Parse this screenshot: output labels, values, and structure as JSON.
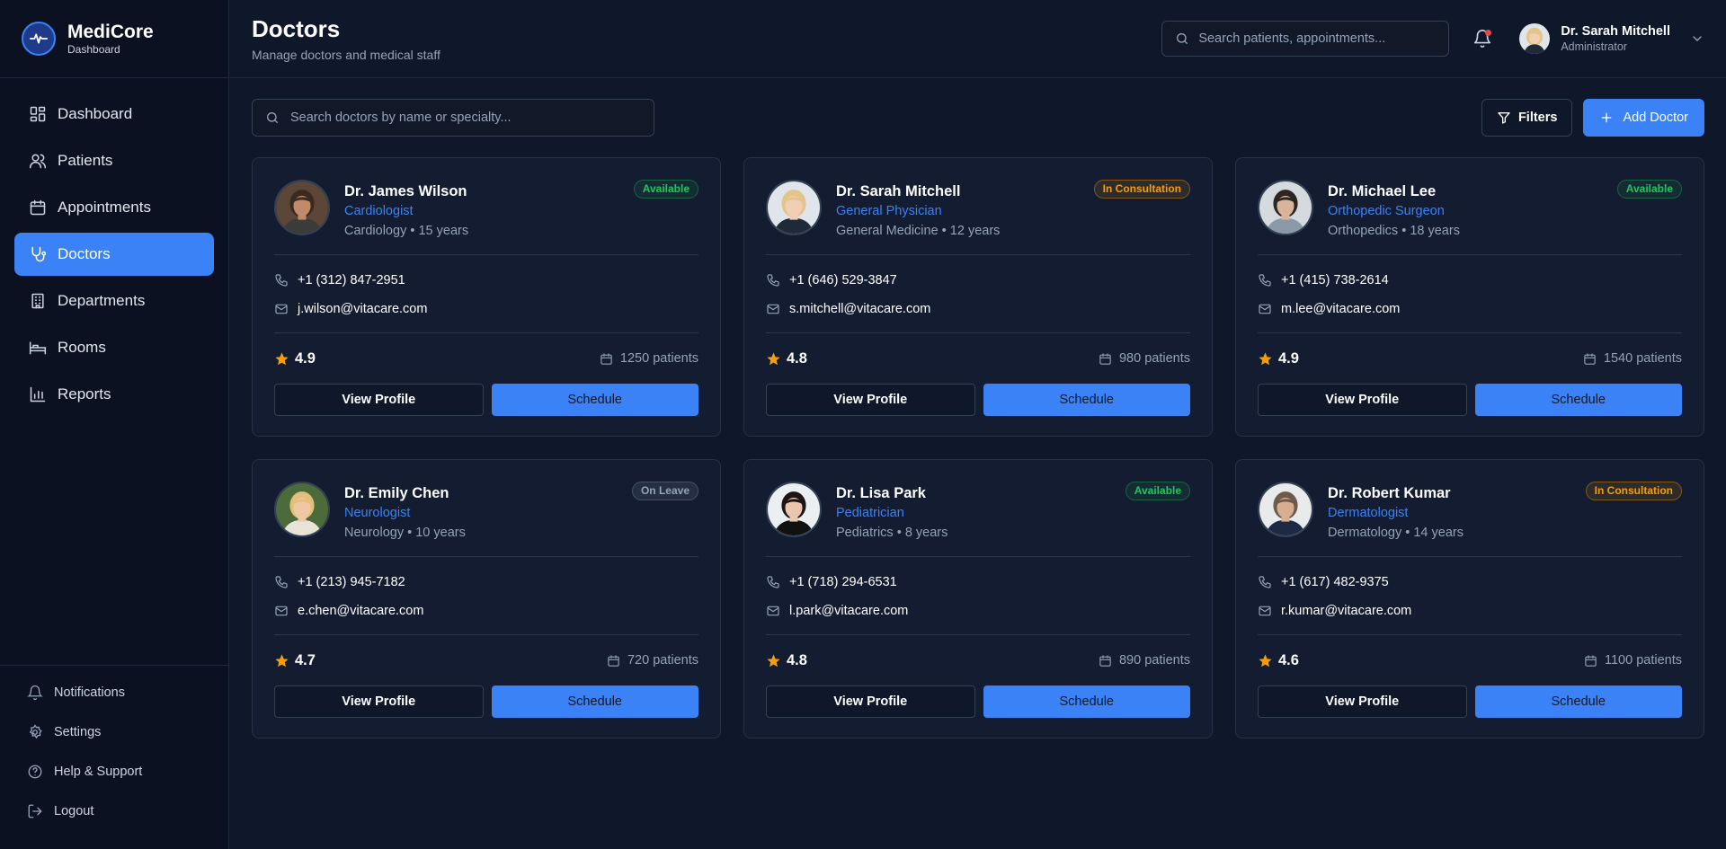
{
  "brand": {
    "name": "MediCore",
    "sub": "Dashboard",
    "accent": "#3b82f6"
  },
  "nav": [
    {
      "label": "Dashboard",
      "icon": "dashboard-icon"
    },
    {
      "label": "Patients",
      "icon": "users-icon"
    },
    {
      "label": "Appointments",
      "icon": "calendar-icon"
    },
    {
      "label": "Doctors",
      "icon": "stethoscope-icon",
      "active": true
    },
    {
      "label": "Departments",
      "icon": "building-icon"
    },
    {
      "label": "Rooms",
      "icon": "bed-icon"
    },
    {
      "label": "Reports",
      "icon": "bar-chart-icon"
    }
  ],
  "sidebar_bottom": [
    {
      "label": "Notifications",
      "icon": "bell-icon"
    },
    {
      "label": "Settings",
      "icon": "gear-icon"
    },
    {
      "label": "Help & Support",
      "icon": "help-icon"
    },
    {
      "label": "Logout",
      "icon": "logout-icon"
    }
  ],
  "header": {
    "title": "Doctors",
    "subtitle": "Manage doctors and medical staff",
    "search_placeholder": "Search patients, appointments...",
    "user_name": "Dr. Sarah Mitchell",
    "user_role": "Administrator"
  },
  "toolbar": {
    "search_placeholder": "Search doctors by name or specialty...",
    "filters_label": "Filters",
    "add_label": "Add Doctor"
  },
  "buttons": {
    "view_profile": "View Profile",
    "schedule": "Schedule"
  },
  "doctors": [
    {
      "name": "Dr. James Wilson",
      "specialty": "Cardiologist",
      "department": "Cardiology",
      "years": "15 years",
      "status": "Available",
      "status_type": "available",
      "phone": "+1 (312) 847-2951",
      "email": "j.wilson@vitacare.com",
      "rating": "4.9",
      "patients": "1250 patients",
      "skin": "#c08a6a",
      "hair": "#3a2a20",
      "bg": "#5b4638",
      "shirt": "#3b3b3b"
    },
    {
      "name": "Dr. Sarah Mitchell",
      "specialty": "General Physician",
      "department": "General Medicine",
      "years": "12 years",
      "status": "In Consultation",
      "status_type": "consult",
      "phone": "+1 (646) 529-3847",
      "email": "s.mitchell@vitacare.com",
      "rating": "4.8",
      "patients": "980 patients",
      "skin": "#f1cfb4",
      "hair": "#e3c489",
      "bg": "#dfe5ea",
      "shirt": "#1f2937"
    },
    {
      "name": "Dr. Michael Lee",
      "specialty": "Orthopedic Surgeon",
      "department": "Orthopedics",
      "years": "18 years",
      "status": "Available",
      "status_type": "available",
      "phone": "+1 (415) 738-2614",
      "email": "m.lee@vitacare.com",
      "rating": "4.9",
      "patients": "1540 patients",
      "skin": "#d9b39a",
      "hair": "#2b2622",
      "bg": "#d5dadf",
      "shirt": "#8a99a8"
    },
    {
      "name": "Dr. Emily Chen",
      "specialty": "Neurologist",
      "department": "Neurology",
      "years": "10 years",
      "status": "On Leave",
      "status_type": "leave",
      "phone": "+1 (213) 945-7182",
      "email": "e.chen@vitacare.com",
      "rating": "4.7",
      "patients": "720 patients",
      "skin": "#f0c7a5",
      "hair": "#e2c07a",
      "bg": "#4d6b3a",
      "shirt": "#e9e4d8"
    },
    {
      "name": "Dr. Lisa Park",
      "specialty": "Pediatrician",
      "department": "Pediatrics",
      "years": "8 years",
      "status": "Available",
      "status_type": "available",
      "phone": "+1 (718) 294-6531",
      "email": "l.park@vitacare.com",
      "rating": "4.8",
      "patients": "890 patients",
      "skin": "#eac6ae",
      "hair": "#1c1513",
      "bg": "#eceff1",
      "shirt": "#111111"
    },
    {
      "name": "Dr. Robert Kumar",
      "specialty": "Dermatologist",
      "department": "Dermatology",
      "years": "14 years",
      "status": "In Consultation",
      "status_type": "consult",
      "phone": "+1 (617) 482-9375",
      "email": "r.kumar@vitacare.com",
      "rating": "4.6",
      "patients": "1100 patients",
      "skin": "#d8ad90",
      "hair": "#6d5a4d",
      "bg": "#e8eaec",
      "shirt": "#1e2a44"
    }
  ]
}
